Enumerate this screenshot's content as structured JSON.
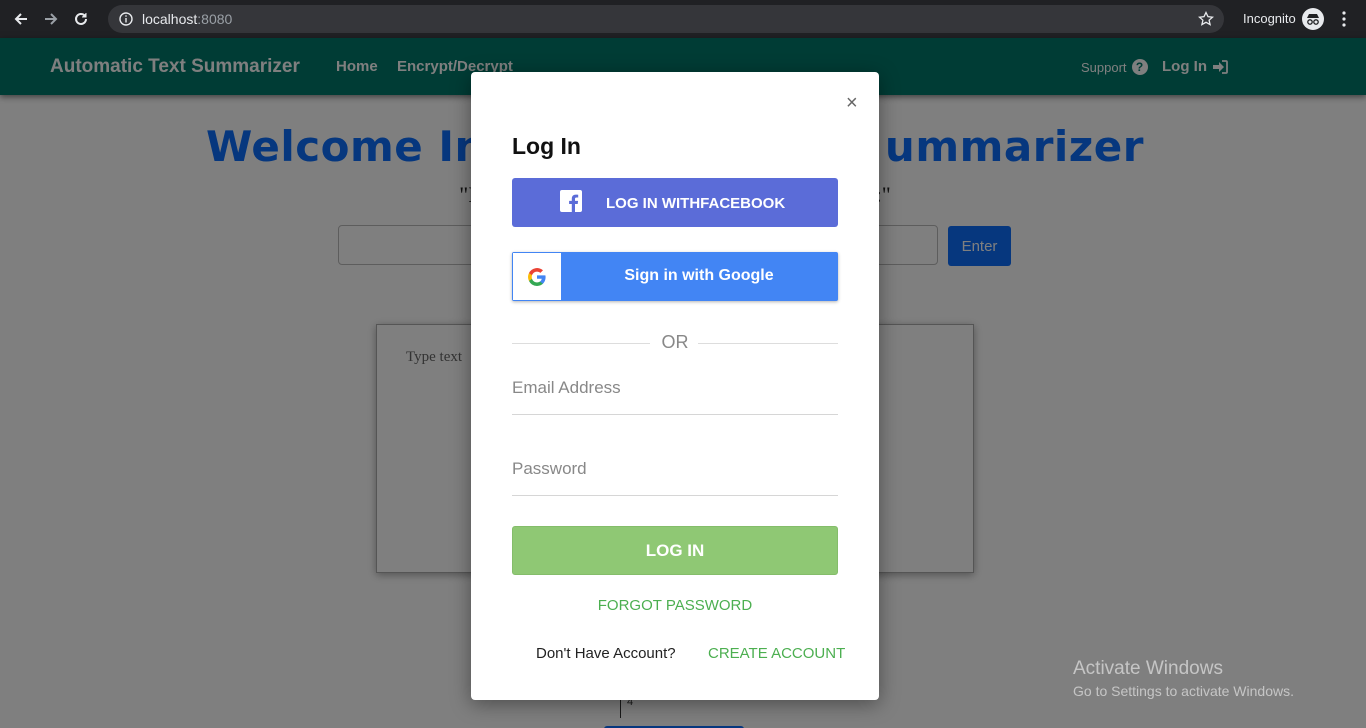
{
  "browser": {
    "url_host": "localhost",
    "url_port": ":8080",
    "incognito_label": "Incognito"
  },
  "navbar": {
    "brand": "Automatic Text Summarizer",
    "links": [
      "Home",
      "Encrypt/Decrypt"
    ],
    "support": "Support",
    "login": "Log In"
  },
  "main": {
    "welcome_left": "Welcome In",
    "welcome_right": "ummarizer",
    "quote_left": "\"I",
    "quote_right": ":\"",
    "enter_button": "Enter",
    "textarea_placeholder": "Type text",
    "counter": "4"
  },
  "modal": {
    "close": "×",
    "title": "Log In",
    "facebook_button": "LOG IN WITHFACEBOOK",
    "google_button": "Sign in with Google",
    "or": "OR",
    "email_placeholder": "Email Address",
    "password_placeholder": "Password",
    "login_button": "LOG IN",
    "forgot_password": "FORGOT PASSWORD",
    "no_account": "Don't Have Account?",
    "create_account": "CREATE ACCOUNT"
  },
  "watermark": {
    "line1": "Activate Windows",
    "line2": "Go to Settings to activate Windows."
  },
  "colors": {
    "navbar": "#00796b",
    "accent_blue": "#0d6efd",
    "facebook": "#5b6cd8",
    "google": "#4285f4",
    "login_green": "#8fc874",
    "link_green": "#4caf50"
  }
}
